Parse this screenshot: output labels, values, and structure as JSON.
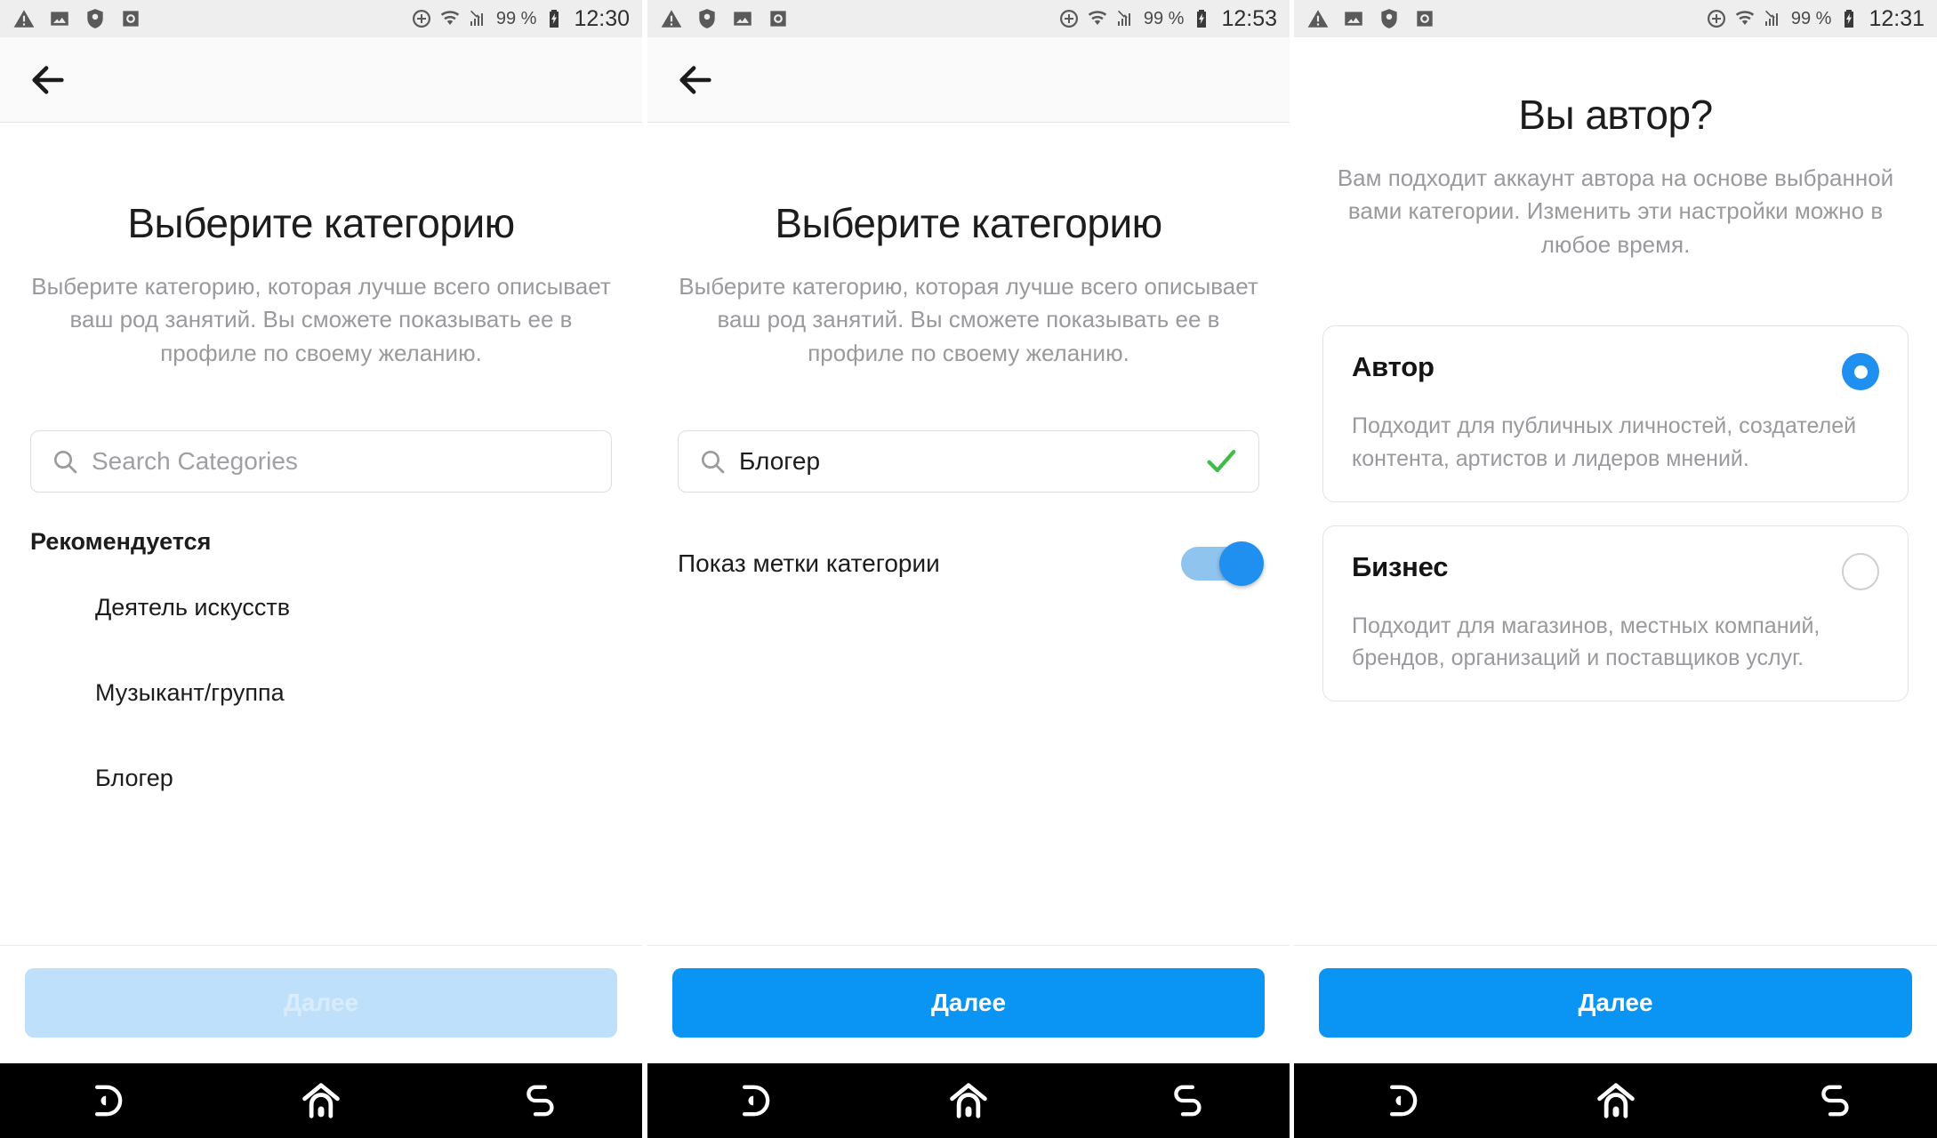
{
  "statusbars": [
    {
      "battery": "99 %",
      "time": "12:30"
    },
    {
      "battery": "99 %",
      "time": "12:53"
    },
    {
      "battery": "99 %",
      "time": "12:31"
    }
  ],
  "status_icons": {
    "warning": "warning-triangle-icon",
    "image": "image-icon",
    "shield": "antivirus-shield-icon",
    "camera": "instagram-camera-icon",
    "sync": "sync-add-icon",
    "wifi": "wifi-icon",
    "signal": "no-signal-icon",
    "battery": "battery-charging-icon"
  },
  "panel1": {
    "back_label": "back-arrow",
    "title": "Выберите категорию",
    "subtitle": "Выберите категорию, которая лучше всего описывает ваш род занятий. Вы сможете показывать ее в профиле по своему желанию.",
    "search": {
      "value": "",
      "placeholder": "Search Categories"
    },
    "section_heading": "Рекомендуется",
    "categories": [
      "Деятель искусств",
      "Музыкант/группа",
      "Блогер"
    ],
    "next_button": "Далее",
    "next_enabled": false
  },
  "panel2": {
    "back_label": "back-arrow",
    "title": "Выберите категорию",
    "subtitle": "Выберите категорию, которая лучше всего описывает ваш род занятий. Вы сможете показывать ее в профиле по своему желанию.",
    "search": {
      "value": "Блогер",
      "placeholder": "Search Categories",
      "validated": true
    },
    "toggle": {
      "label": "Показ метки категории",
      "on": true
    },
    "next_button": "Далее",
    "next_enabled": true
  },
  "panel3": {
    "title": "Вы автор?",
    "subtitle": "Вам подходит аккаунт автора на основе выбранной вами категории. Изменить эти настройки можно в любое время.",
    "options": [
      {
        "title": "Автор",
        "description": "Подходит для публичных личностей, создателей контента, артистов и лидеров мнений.",
        "selected": true
      },
      {
        "title": "Бизнес",
        "description": "Подходит для магазинов, местных компаний, брендов, организаций и поставщиков услуг.",
        "selected": false
      }
    ],
    "next_button": "Далее",
    "next_enabled": true
  },
  "navbar": {
    "items": [
      "recents-icon",
      "home-icon",
      "back-gesture-icon"
    ]
  },
  "colors": {
    "accent_blue": "#0a95f5",
    "accent_blue_disabled": "#bfe0fb",
    "toggle_track": "#8fc4ee",
    "toggle_knob": "#1f8ff0",
    "check_green": "#3fbb4a",
    "muted_text": "#9a9a9e",
    "statusbar_bg": "#eeeeee",
    "navbar_bg": "#000000"
  }
}
